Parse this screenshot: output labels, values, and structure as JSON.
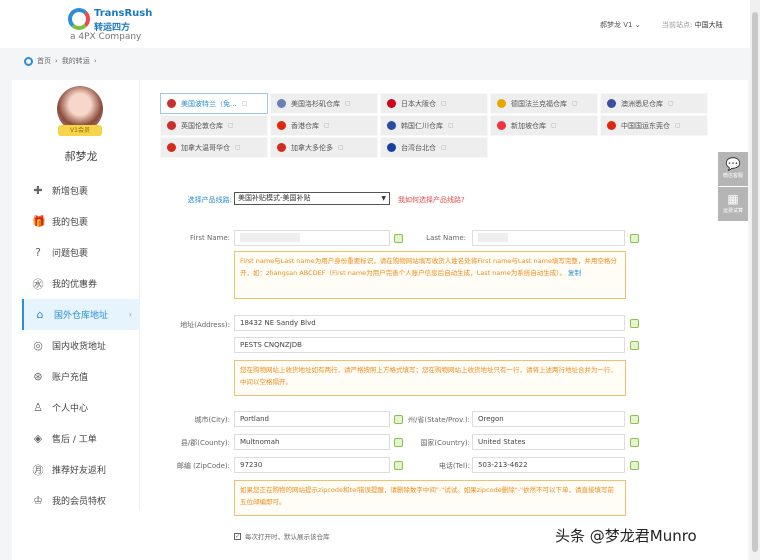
{
  "header": {
    "logo_en": "TransRush",
    "logo_cn": "转运四方",
    "logo_sub": "a 4PX Company",
    "user": "郝梦龙 V1",
    "site_label": "当前站点:",
    "site_value": "中国大陆"
  },
  "breadcrumb": [
    "首页",
    "我的转运"
  ],
  "sidebar": {
    "vip": "V1会员",
    "name": "郝梦龙",
    "items": [
      {
        "label": "新增包裹",
        "icon": "plus-icon"
      },
      {
        "label": "我的包裹",
        "icon": "gift-icon"
      },
      {
        "label": "问题包裹",
        "icon": "question-icon"
      },
      {
        "label": "我的优惠券",
        "icon": "coupon-icon"
      },
      {
        "label": "国外仓库地址",
        "icon": "home-icon",
        "active": true
      },
      {
        "label": "国内收货地址",
        "icon": "location-icon"
      },
      {
        "label": "账户充值",
        "icon": "recharge-icon"
      },
      {
        "label": "个人中心",
        "icon": "user-icon"
      },
      {
        "label": "售后 / 工单",
        "icon": "service-icon"
      },
      {
        "label": "推荐好友返利",
        "icon": "referral-icon"
      },
      {
        "label": "我的会员特权",
        "icon": "vip-icon"
      }
    ]
  },
  "tabs": [
    {
      "label": "美国波特兰（免...",
      "color": "#c9302c"
    },
    {
      "label": "美国洛杉矶仓库",
      "color": "#6b7fb5"
    },
    {
      "label": "日本大阪仓",
      "color": "#d0021b"
    },
    {
      "label": "德国法兰克福仓库",
      "color": "#e6a800"
    },
    {
      "label": "澳洲悉尼仓库",
      "color": "#3b4ea0"
    },
    {
      "label": "英国伦敦仓库",
      "color": "#c9302c"
    },
    {
      "label": "香港仓库",
      "color": "#de2910"
    },
    {
      "label": "韩国仁川仓库",
      "color": "#2a4da0"
    },
    {
      "label": "新加坡仓库",
      "color": "#ef3340"
    },
    {
      "label": "中国国运东莞仓",
      "color": "#de2910"
    },
    {
      "label": "加拿大温哥华仓",
      "color": "#d52b1e"
    },
    {
      "label": "加拿大多伦多",
      "color": "#d52b1e"
    },
    {
      "label": "台湾台北仓",
      "color": "#1a3fa0"
    }
  ],
  "form": {
    "route_label": "选择产品线路:",
    "route_value": "美国补贴模式-美国补贴",
    "route_help": "我如何选择产品线路?",
    "first_name_label": "First Name:",
    "last_name_label": "Last Name:",
    "name_note": "First name与Last name为用户身份重要标识，请在购物网站填写收货人姓名处将First name与Last name填写完整，并用空格分开，如：zhangsan ABCDEF（First name为用户完善个人账户信息后自动生成，Last name为系统自动生成）。",
    "name_note_link": "复制",
    "address_label": "地址(Address):",
    "address1": "18432 NE Sandy Blvd",
    "address2": "PESTS CNQNZJDB",
    "address_note": "您在购物网站上收货地址如有两行，请严格按照上方格式填写；您在购物网站上收货地址只有一行，请将上述两行地址合并为一行，中间以空格隔开。",
    "city_label": "城市(City):",
    "city": "Portland",
    "state_label": "州/省(State/Prov.):",
    "state": "Oregon",
    "county_label": "县/郡(County):",
    "county": "Multnomah",
    "country_label": "国家(Country):",
    "country": "United States",
    "zip_label": "邮编 (ZipCode):",
    "zip": "97230",
    "tel_label": "电话(Tel):",
    "tel": "503-213-4622",
    "zip_note": "如果您正在购物的网站提示zipcode和tel错误提醒，请删除数字中间\"-\"试试。如果zipcode删除\"-\"依然不可以下单，请直接填写前五位邮编即可。",
    "default_label": "每次打开时，默认展示该仓库"
  },
  "float": {
    "wechat": "微信客服",
    "calc": "运费试算"
  },
  "watermark": "头条 @梦龙君Munro"
}
